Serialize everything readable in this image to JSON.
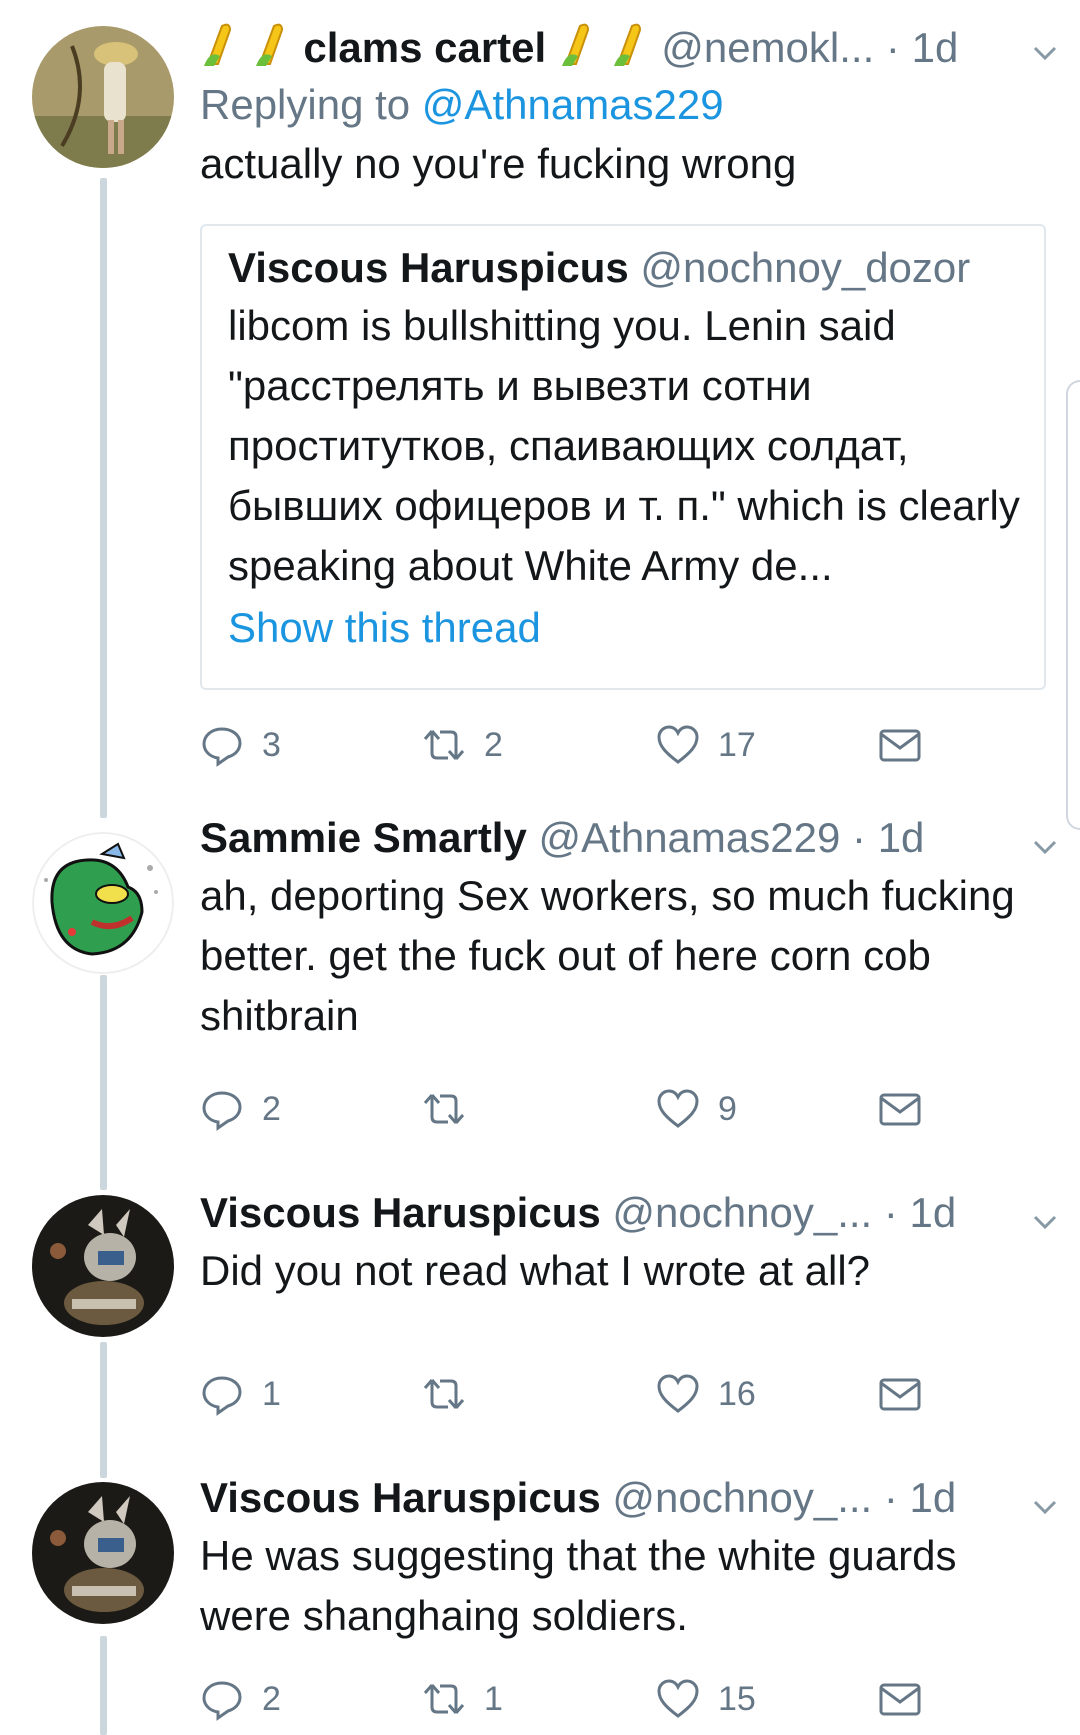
{
  "tweets": [
    {
      "name": "clams cartel",
      "handle": "@nemokl...",
      "dot": "·",
      "time": "1d",
      "reply_prefix": "Replying to",
      "reply_mention": "@Athnamas229",
      "text": "actually no you're fucking wrong",
      "quote": {
        "name": "Viscous Haruspicus",
        "handle": "@nochnoy_dozor",
        "text": "libcom is bullshitting you. Lenin said \"расстрелять и вывезти сотни проститутков, спаивающих солдат, бывших офицеров и т. п.\" which is clearly speaking about White Army de...",
        "show_thread": "Show this thread"
      },
      "replies": "3",
      "retweets": "2",
      "likes": "17"
    },
    {
      "name": "Sammie Smartly",
      "handle": "@Athnamas229",
      "dot": "·",
      "time": "1d",
      "text": "ah, deporting Sex workers, so much fucking better. get the fuck out of here corn cob shitbrain",
      "replies": "2",
      "retweets": "",
      "likes": "9"
    },
    {
      "name": "Viscous Haruspicus",
      "handle": "@nochnoy_...",
      "dot": "·",
      "time": "1d",
      "text": "Did you not read what I wrote at all?",
      "replies": "1",
      "retweets": "",
      "likes": "16"
    },
    {
      "name": "Viscous Haruspicus",
      "handle": "@nochnoy_...",
      "dot": "·",
      "time": "1d",
      "text": "He was suggesting that the white guards were shanghaing soldiers.",
      "replies": "2",
      "retweets": "1",
      "likes": "15"
    }
  ],
  "icons": {
    "reply": "reply-icon",
    "retweet": "retweet-icon",
    "like": "heart-icon",
    "dm": "envelope-icon",
    "caret": "chevron-down-icon",
    "corn": "corn-emoji-icon"
  },
  "colors": {
    "text": "#14171a",
    "muted": "#657786",
    "link": "#1b95e0",
    "thread_line": "#ccd6dd",
    "border": "#e1e8ed"
  }
}
